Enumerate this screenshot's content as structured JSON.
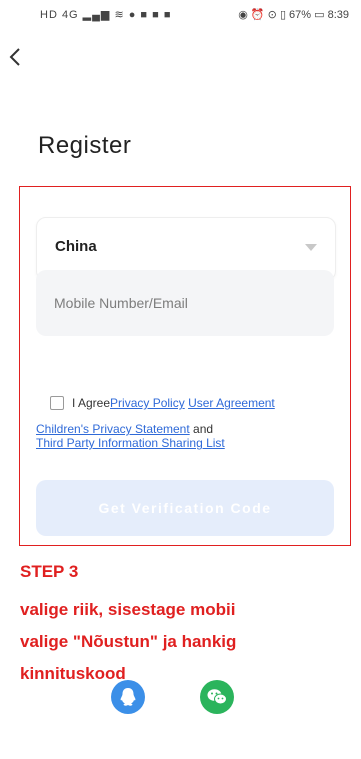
{
  "status_bar": {
    "left_icons": "HD 4G ▂▄▆ ≋ ● ■ ■ ■",
    "right_text": "◉ ⏰ ⊙ ▯ 67% ▭ 8:39"
  },
  "page": {
    "title": "Register"
  },
  "form": {
    "country": "China",
    "account_placeholder": "Mobile Number/Email",
    "agree_prefix": "I Agree",
    "privacy_policy": "Privacy Policy",
    "user_agreement": "User Agreement",
    "childrens_privacy": "Children's Privacy Statement",
    "and_text": "and",
    "third_party": "Third Party Information Sharing List",
    "get_code_label": "Get Verification Code"
  },
  "annotation": {
    "step": "STEP 3",
    "line1": "valige riik, sisestage mobii",
    "line2": "valige \"Nõustun\" ja hankig",
    "line3": "kinnituskood"
  },
  "social": {
    "icons": [
      "qq-icon",
      "wechat-icon"
    ]
  },
  "colors": {
    "accent": "#e02020",
    "link": "#2f6ad8",
    "button_disabled": "#e5edfb",
    "qq": "#3b8fe8",
    "wechat": "#2bb45c"
  }
}
